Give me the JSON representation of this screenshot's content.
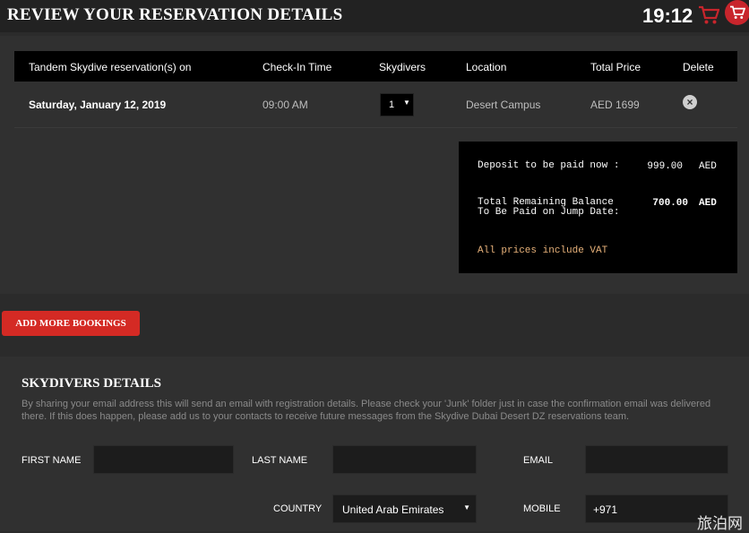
{
  "header": {
    "title": "REVIEW YOUR RESERVATION DETAILS",
    "clock": "19:12"
  },
  "table": {
    "headers": [
      "Tandem Skydive reservation(s) on",
      "Check-In Time",
      "Skydivers",
      "Location",
      "Total Price",
      "Delete"
    ],
    "row": {
      "date": "Saturday, January 12, 2019",
      "time": "09:00 AM",
      "skydivers": "1",
      "location": "Desert Campus",
      "price": "AED 1699"
    }
  },
  "summary": {
    "deposit_label": "Deposit to be paid now :",
    "deposit_amount": "999.00",
    "deposit_currency": "AED",
    "remaining_label": "Total Remaining Balance To Be Paid on Jump Date:",
    "remaining_amount": "700.00",
    "remaining_currency": "AED",
    "vat_note": "All prices include VAT"
  },
  "add_button": "ADD MORE BOOKINGS",
  "skydivers": {
    "title": "SKYDIVERS DETAILS",
    "description": "By sharing your email address this will send an email with registration details. Please check your 'Junk' folder just in case the confirmation email was delivered there. If this does happen, please add us to your contacts to receive future messages from the Skydive Dubai Desert DZ reservations team.",
    "first_name_label": "FIRST NAME",
    "first_name_value": "",
    "last_name_label": "LAST NAME",
    "last_name_value": "",
    "email_label": "EMAIL",
    "email_value": "",
    "country_label": "COUNTRY",
    "country_value": "United Arab Emirates",
    "mobile_label": "MOBILE",
    "mobile_value": "+971"
  },
  "watermark": "旅泊网",
  "colors": {
    "accent": "#d42a24",
    "vat": "#e8b27a",
    "panel": "#303030"
  },
  "icons": [
    "cart-icon",
    "cart-badge-icon",
    "delete-icon",
    "chevron-down-icon"
  ]
}
